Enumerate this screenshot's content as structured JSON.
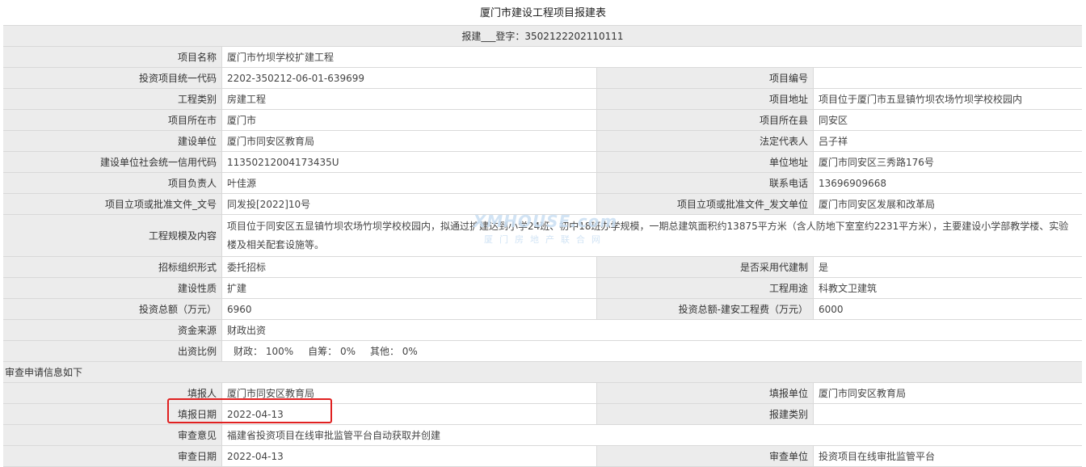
{
  "title": "厦门市建设工程项目报建表",
  "registration": "报建___登字：3502122202110111",
  "fields": {
    "project_name": {
      "label": "项目名称",
      "value": "厦门市竹坝学校扩建工程"
    },
    "invest_code": {
      "label": "投资项目统一代码",
      "value": "2202-350212-06-01-639699"
    },
    "project_no": {
      "label": "项目编号",
      "value": ""
    },
    "eng_type": {
      "label": "工程类别",
      "value": "房建工程"
    },
    "address": {
      "label": "项目地址",
      "value": "项目位于厦门市五显镇竹坝农场竹坝学校校园内"
    },
    "city": {
      "label": "项目所在市",
      "value": "厦门市"
    },
    "county": {
      "label": "项目所在县",
      "value": "同安区"
    },
    "builder": {
      "label": "建设单位",
      "value": "厦门市同安区教育局"
    },
    "legal_rep": {
      "label": "法定代表人",
      "value": "吕子祥"
    },
    "credit_code": {
      "label": "建设单位社会统一信用代码",
      "value": "11350212004173435U"
    },
    "unit_address": {
      "label": "单位地址",
      "value": "厦门市同安区三秀路176号"
    },
    "leader": {
      "label": "项目负责人",
      "value": "叶佳源"
    },
    "phone": {
      "label": "联系电话",
      "value": "13696909668"
    },
    "approval_doc": {
      "label": "项目立项或批准文件_文号",
      "value": "同发投[2022]10号"
    },
    "approval_unit": {
      "label": "项目立项或批准文件_发文单位",
      "value": "厦门市同安区发展和改革局"
    },
    "scale": {
      "label": "工程规模及内容",
      "value": "项目位于同安区五显镇竹坝农场竹坝学校校园内，拟通过扩建达到小学24班、初中18班办学规模，一期总建筑面积约13875平方米（含人防地下室室约2231平方米），主要建设小学部教学楼、实验楼及相关配套设施等。"
    },
    "bidding": {
      "label": "招标组织形式",
      "value": "委托招标"
    },
    "agent_build": {
      "label": "是否采用代建制",
      "value": "是"
    },
    "nature": {
      "label": "建设性质",
      "value": "扩建"
    },
    "usage": {
      "label": "工程用途",
      "value": "科教文卫建筑"
    },
    "total_invest": {
      "label": "投资总额（万元）",
      "value": "6960"
    },
    "build_cost": {
      "label": "投资总额-建安工程费（万元）",
      "value": "6000"
    },
    "fund_source": {
      "label": "资金来源",
      "value": "财政出资"
    },
    "fund_ratio": {
      "label": "出资比例",
      "fiscal": "财政：  100%",
      "self": "自筹：  0%",
      "other": "其他：  0%"
    }
  },
  "review_header": "审查申请信息如下",
  "review": {
    "filler": {
      "label": "填报人",
      "value": "厦门市同安区教育局"
    },
    "filler_unit": {
      "label": "填报单位",
      "value": "厦门市同安区教育局"
    },
    "fill_date": {
      "label": "填报日期",
      "value": "2022-04-13"
    },
    "report_type": {
      "label": "报建类别",
      "value": ""
    },
    "opinion": {
      "label": "审查意见",
      "value": "福建省投资项目在线审批监管平台自动获取并创建"
    },
    "review_date": {
      "label": "审查日期",
      "value": "2022-04-13"
    },
    "review_unit": {
      "label": "审查单位",
      "value": "投资项目在线审批监管平台"
    }
  },
  "watermark": {
    "line1": "XMHOUSE.com",
    "line2": "厦门房地产联合网"
  },
  "colors": {
    "label_bg": "#ececec",
    "border": "#d9d9d9",
    "highlight": "#e02020"
  }
}
